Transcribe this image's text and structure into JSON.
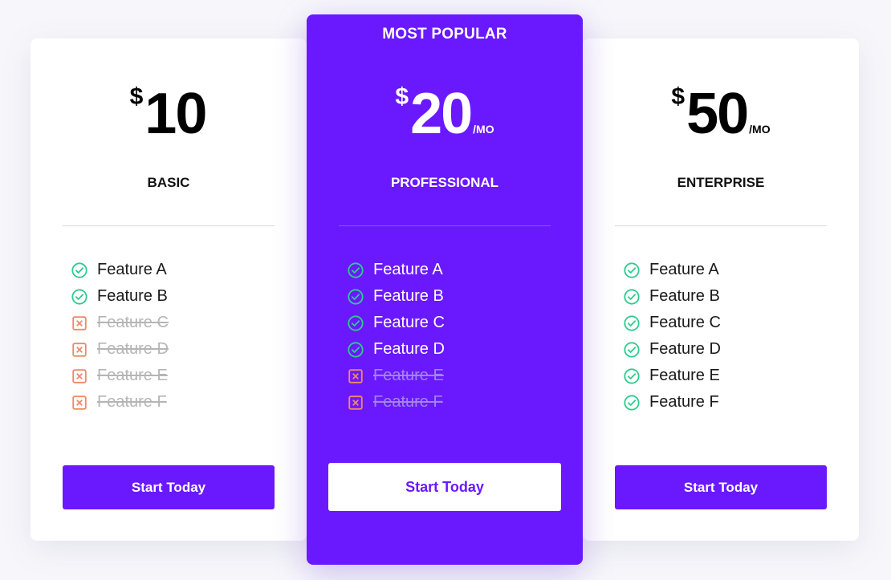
{
  "colors": {
    "accent": "#6a19ff",
    "check": "#2ecc8f",
    "cross": "#f08a65",
    "background": "#f7f7fb"
  },
  "plans": {
    "basic": {
      "currency": "$",
      "amount": "10",
      "period": "",
      "name": "BASIC",
      "features": [
        {
          "label": "Feature A",
          "included": true
        },
        {
          "label": "Feature B",
          "included": true
        },
        {
          "label": "Feature C",
          "included": false
        },
        {
          "label": "Feature D",
          "included": false
        },
        {
          "label": "Feature E",
          "included": false
        },
        {
          "label": "Feature F",
          "included": false
        }
      ],
      "button": "Start Today"
    },
    "professional": {
      "badge": "MOST POPULAR",
      "currency": "$",
      "amount": "20",
      "period": "/MO",
      "name": "PROFESSIONAL",
      "features": [
        {
          "label": "Feature A",
          "included": true
        },
        {
          "label": "Feature B",
          "included": true
        },
        {
          "label": "Feature C",
          "included": true
        },
        {
          "label": "Feature D",
          "included": true
        },
        {
          "label": "Feature E",
          "included": false
        },
        {
          "label": "Feature F",
          "included": false
        }
      ],
      "button": "Start Today"
    },
    "enterprise": {
      "currency": "$",
      "amount": "50",
      "period": "/MO",
      "name": "ENTERPRISE",
      "features": [
        {
          "label": "Feature A",
          "included": true
        },
        {
          "label": "Feature B",
          "included": true
        },
        {
          "label": "Feature C",
          "included": true
        },
        {
          "label": "Feature D",
          "included": true
        },
        {
          "label": "Feature E",
          "included": true
        },
        {
          "label": "Feature F",
          "included": true
        }
      ],
      "button": "Start Today"
    }
  },
  "icons": {
    "included": "check-circle-icon",
    "excluded": "x-square-icon"
  }
}
